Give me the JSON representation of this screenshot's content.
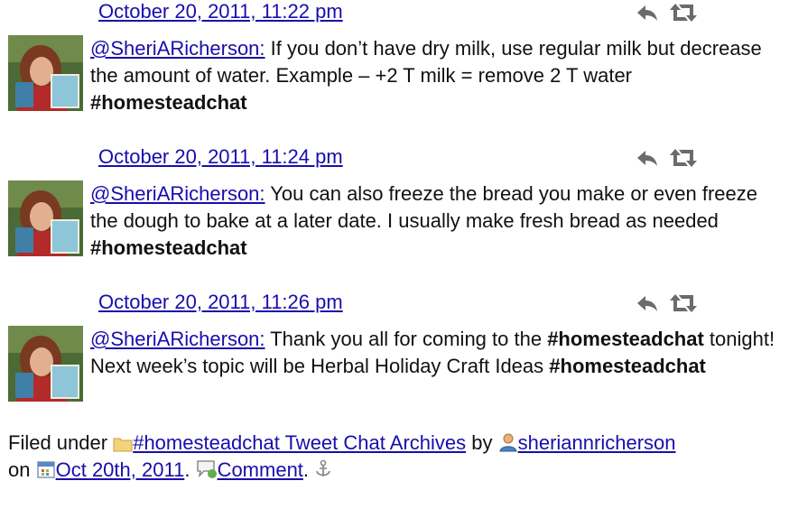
{
  "tweets": [
    {
      "timestamp": "October 20, 2011, 11:22 pm",
      "user": "@SheriARicherson:",
      "text": " If you don’t have dry milk, use regular milk but decrease the amount of water. Example – +2 T milk = remove 2 T water ",
      "hashtag": "#homesteadchat",
      "tail": ""
    },
    {
      "timestamp": "October 20, 2011, 11:24 pm",
      "user": "@SheriARicherson:",
      "text": " You can also freeze the bread you make or even freeze the dough to bake at a later date. I usually make fresh bread as needed ",
      "hashtag": "#homesteadchat",
      "tail": ""
    },
    {
      "timestamp": "October 20, 2011, 11:26 pm",
      "user": "@SheriARicherson:",
      "text": " Thank you all for coming to the ",
      "hashtag": "#homesteadchat",
      "tail": " tonight! Next week’s topic will be Herbal Holiday Craft Ideas ",
      "hashtag2": "#homesteadchat"
    }
  ],
  "footer": {
    "filed_under": "Filed under",
    "category": "#homesteadchat Tweet Chat Archives",
    "by": "by",
    "author": "sheriannricherson",
    "on": "on",
    "date": "Oct 20th, 2011",
    "period1": ".",
    "comment": "Comment",
    "period2": "."
  },
  "icons": {
    "reply": "reply-icon",
    "retweet": "retweet-icon",
    "folder": "folder-icon",
    "user": "user-icon",
    "calendar": "calendar-icon",
    "comment": "comment-icon",
    "anchor": "anchor-icon"
  },
  "colors": {
    "link": "#1a0dab",
    "icon_gray": "#6b6b6b"
  }
}
